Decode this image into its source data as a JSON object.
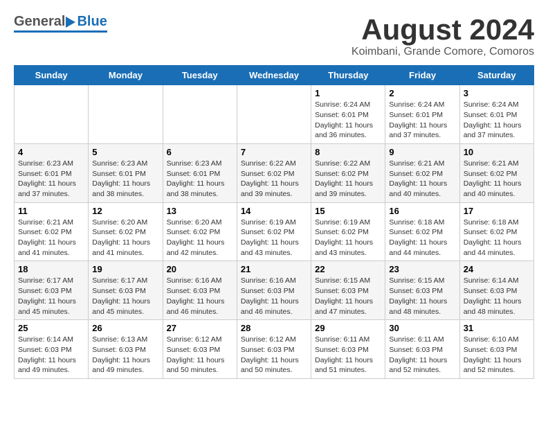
{
  "header": {
    "logo_general": "General",
    "logo_blue": "Blue",
    "main_title": "August 2024",
    "subtitle": "Koimbani, Grande Comore, Comoros"
  },
  "calendar": {
    "weekdays": [
      "Sunday",
      "Monday",
      "Tuesday",
      "Wednesday",
      "Thursday",
      "Friday",
      "Saturday"
    ],
    "weeks": [
      [
        {
          "day": "",
          "info": ""
        },
        {
          "day": "",
          "info": ""
        },
        {
          "day": "",
          "info": ""
        },
        {
          "day": "",
          "info": ""
        },
        {
          "day": "1",
          "info": "Sunrise: 6:24 AM\nSunset: 6:01 PM\nDaylight: 11 hours\nand 36 minutes."
        },
        {
          "day": "2",
          "info": "Sunrise: 6:24 AM\nSunset: 6:01 PM\nDaylight: 11 hours\nand 37 minutes."
        },
        {
          "day": "3",
          "info": "Sunrise: 6:24 AM\nSunset: 6:01 PM\nDaylight: 11 hours\nand 37 minutes."
        }
      ],
      [
        {
          "day": "4",
          "info": "Sunrise: 6:23 AM\nSunset: 6:01 PM\nDaylight: 11 hours\nand 37 minutes."
        },
        {
          "day": "5",
          "info": "Sunrise: 6:23 AM\nSunset: 6:01 PM\nDaylight: 11 hours\nand 38 minutes."
        },
        {
          "day": "6",
          "info": "Sunrise: 6:23 AM\nSunset: 6:01 PM\nDaylight: 11 hours\nand 38 minutes."
        },
        {
          "day": "7",
          "info": "Sunrise: 6:22 AM\nSunset: 6:02 PM\nDaylight: 11 hours\nand 39 minutes."
        },
        {
          "day": "8",
          "info": "Sunrise: 6:22 AM\nSunset: 6:02 PM\nDaylight: 11 hours\nand 39 minutes."
        },
        {
          "day": "9",
          "info": "Sunrise: 6:21 AM\nSunset: 6:02 PM\nDaylight: 11 hours\nand 40 minutes."
        },
        {
          "day": "10",
          "info": "Sunrise: 6:21 AM\nSunset: 6:02 PM\nDaylight: 11 hours\nand 40 minutes."
        }
      ],
      [
        {
          "day": "11",
          "info": "Sunrise: 6:21 AM\nSunset: 6:02 PM\nDaylight: 11 hours\nand 41 minutes."
        },
        {
          "day": "12",
          "info": "Sunrise: 6:20 AM\nSunset: 6:02 PM\nDaylight: 11 hours\nand 41 minutes."
        },
        {
          "day": "13",
          "info": "Sunrise: 6:20 AM\nSunset: 6:02 PM\nDaylight: 11 hours\nand 42 minutes."
        },
        {
          "day": "14",
          "info": "Sunrise: 6:19 AM\nSunset: 6:02 PM\nDaylight: 11 hours\nand 43 minutes."
        },
        {
          "day": "15",
          "info": "Sunrise: 6:19 AM\nSunset: 6:02 PM\nDaylight: 11 hours\nand 43 minutes."
        },
        {
          "day": "16",
          "info": "Sunrise: 6:18 AM\nSunset: 6:02 PM\nDaylight: 11 hours\nand 44 minutes."
        },
        {
          "day": "17",
          "info": "Sunrise: 6:18 AM\nSunset: 6:02 PM\nDaylight: 11 hours\nand 44 minutes."
        }
      ],
      [
        {
          "day": "18",
          "info": "Sunrise: 6:17 AM\nSunset: 6:03 PM\nDaylight: 11 hours\nand 45 minutes."
        },
        {
          "day": "19",
          "info": "Sunrise: 6:17 AM\nSunset: 6:03 PM\nDaylight: 11 hours\nand 45 minutes."
        },
        {
          "day": "20",
          "info": "Sunrise: 6:16 AM\nSunset: 6:03 PM\nDaylight: 11 hours\nand 46 minutes."
        },
        {
          "day": "21",
          "info": "Sunrise: 6:16 AM\nSunset: 6:03 PM\nDaylight: 11 hours\nand 46 minutes."
        },
        {
          "day": "22",
          "info": "Sunrise: 6:15 AM\nSunset: 6:03 PM\nDaylight: 11 hours\nand 47 minutes."
        },
        {
          "day": "23",
          "info": "Sunrise: 6:15 AM\nSunset: 6:03 PM\nDaylight: 11 hours\nand 48 minutes."
        },
        {
          "day": "24",
          "info": "Sunrise: 6:14 AM\nSunset: 6:03 PM\nDaylight: 11 hours\nand 48 minutes."
        }
      ],
      [
        {
          "day": "25",
          "info": "Sunrise: 6:14 AM\nSunset: 6:03 PM\nDaylight: 11 hours\nand 49 minutes."
        },
        {
          "day": "26",
          "info": "Sunrise: 6:13 AM\nSunset: 6:03 PM\nDaylight: 11 hours\nand 49 minutes."
        },
        {
          "day": "27",
          "info": "Sunrise: 6:12 AM\nSunset: 6:03 PM\nDaylight: 11 hours\nand 50 minutes."
        },
        {
          "day": "28",
          "info": "Sunrise: 6:12 AM\nSunset: 6:03 PM\nDaylight: 11 hours\nand 50 minutes."
        },
        {
          "day": "29",
          "info": "Sunrise: 6:11 AM\nSunset: 6:03 PM\nDaylight: 11 hours\nand 51 minutes."
        },
        {
          "day": "30",
          "info": "Sunrise: 6:11 AM\nSunset: 6:03 PM\nDaylight: 11 hours\nand 52 minutes."
        },
        {
          "day": "31",
          "info": "Sunrise: 6:10 AM\nSunset: 6:03 PM\nDaylight: 11 hours\nand 52 minutes."
        }
      ]
    ]
  }
}
